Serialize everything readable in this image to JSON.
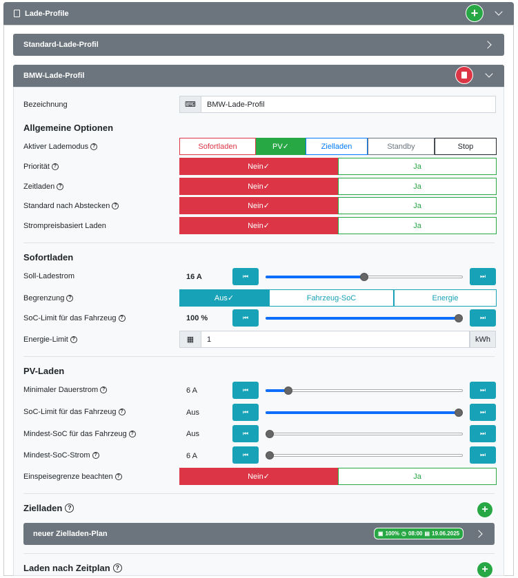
{
  "header": {
    "title": "Lade-Profile",
    "add_icon": "plus-icon",
    "expand_icon": "chevron-down-icon"
  },
  "profiles": {
    "standard": {
      "title": "Standard-Lade-Profil"
    },
    "bmw": {
      "title": "BMW-Lade-Profil",
      "delete_icon": "trash-icon"
    }
  },
  "form": {
    "name_label": "Bezeichnung",
    "name_value": "BMW-Lade-Profil",
    "general_heading": "Allgemeine Optionen",
    "mode_label": "Aktiver Lademodus",
    "modes": [
      "Sofortladen",
      "PV✓",
      "Zielladen",
      "Standby",
      "Stop"
    ],
    "rows": [
      {
        "label": "Priorität",
        "no": "Nein✓",
        "yes": "Ja"
      },
      {
        "label": "Zeitladen",
        "no": "Nein✓",
        "yes": "Ja"
      },
      {
        "label": "Standard nach Abstecken",
        "no": "Nein✓",
        "yes": "Ja"
      },
      {
        "label": "Strompreisbasiert Laden",
        "no": "Nein✓",
        "yes": "Ja"
      }
    ],
    "sofort_heading": "Sofortladen",
    "soll_label": "Soll-Ladestrom",
    "soll_value": "16 A",
    "soll_level": 0.5,
    "begrenzung_label": "Begrenzung",
    "begrenzung_options": [
      "Aus✓",
      "Fahrzeug-SoC",
      "Energie"
    ],
    "soc_limit_label": "SoC-Limit für das Fahrzeug",
    "soc_limit_value": "100 %",
    "soc_limit_level": 1.0,
    "energie_label": "Energie-Limit",
    "energie_value": "1",
    "energie_unit": "kWh",
    "pv_heading": "PV-Laden",
    "min_strom_label": "Minimaler Dauerstrom",
    "min_strom_value": "6 A",
    "min_strom_level": 0.1,
    "pv_soc_label": "SoC-Limit für das Fahrzeug",
    "pv_soc_value": "Aus",
    "pv_soc_level": 1.0,
    "min_soc_label": "Mindest-SoC für das Fahrzeug",
    "min_soc_value": "Aus",
    "min_soc_level": 0.0,
    "min_soc_strom_label": "Mindest-SoC-Strom",
    "min_soc_strom_value": "6 A",
    "min_soc_strom_level": 0.0,
    "einspeise_label": "Einspeisegrenze beachten",
    "einspeise_no": "Nein✓",
    "einspeise_yes": "Ja",
    "ziel_heading": "Zielladen",
    "plan_title": "neuer Zielladen-Plan",
    "plan_badge": {
      "soc": "100%",
      "time": "08:00",
      "date": "19.06.2025"
    },
    "zeitplan_heading": "Laden nach Zeitplan"
  }
}
